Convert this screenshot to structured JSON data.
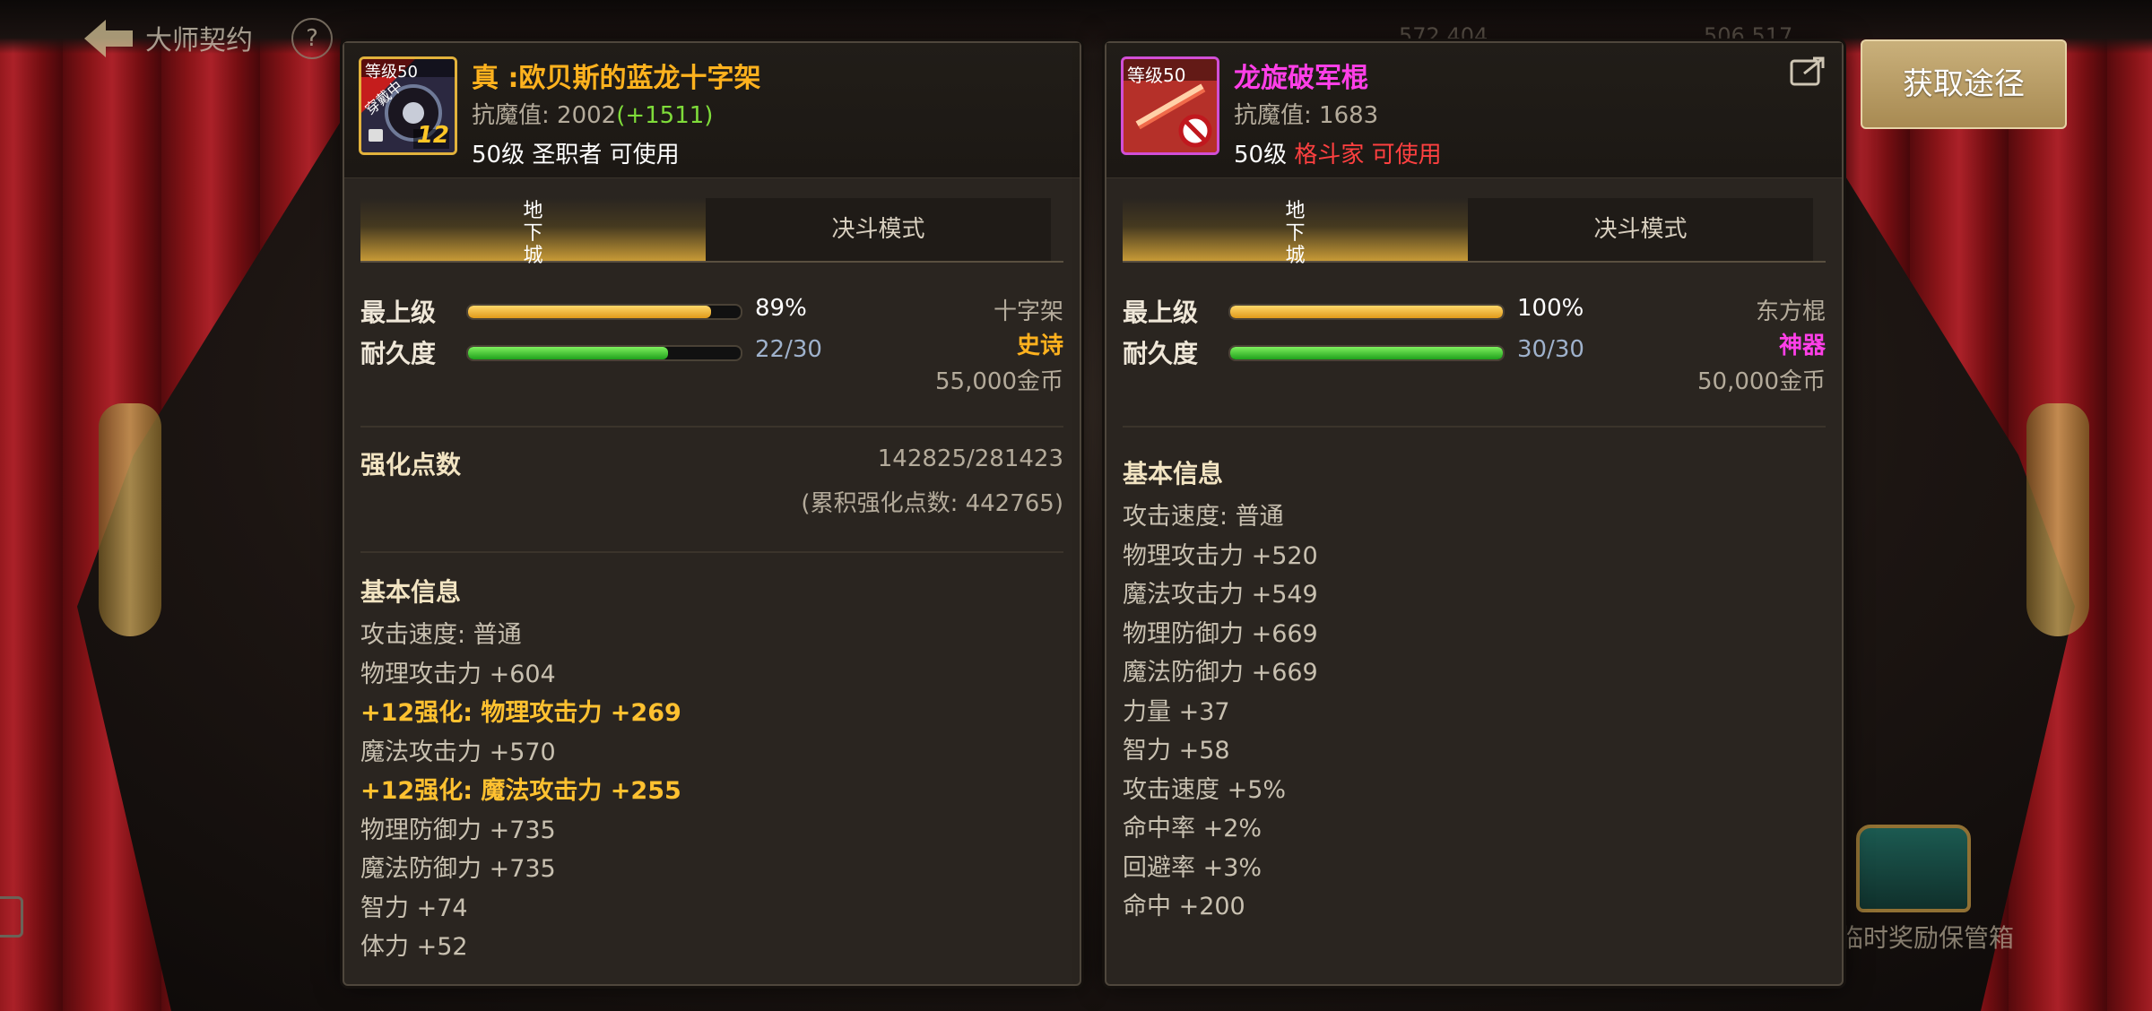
{
  "background": {
    "title": "大师契约",
    "help_icon": "?",
    "chest_label": "临时奖励保管箱",
    "behind_numbers": [
      "572,404",
      "506,517"
    ]
  },
  "button": {
    "obtain_label": "获取途径"
  },
  "left_item": {
    "name": "真 :欧贝斯的蓝龙十字架",
    "name_color": "#ffb21e",
    "icon_badge_top": "等级50",
    "icon_ribbon": "穿戴中",
    "icon_level": "12",
    "resist_label": "抗魔值:",
    "resist_value": "2002",
    "resist_bonus": "(+1511)",
    "req_level": "50级",
    "req_class": "圣职者",
    "req_usable": "可使用",
    "tabs": {
      "active": "地下城",
      "inactive": "决斗模式"
    },
    "top_label": "最上级",
    "top_percent": 89,
    "top_text": "89%",
    "dur_label": "耐久度",
    "dur_fraction": 0.7333,
    "dur_text": "22/30",
    "type": "十字架",
    "rarity": "史诗",
    "price": "55,000金币",
    "enhance_title": "强化点数",
    "enhance_value": "142825/281423",
    "enhance_total": "(累积强化点数: 442765)",
    "info_title": "基本信息",
    "info_lines": [
      {
        "text": "攻击速度: 普通",
        "style": "normal"
      },
      {
        "text": "物理攻击力 +604",
        "style": "normal"
      },
      {
        "text": "+12强化: 物理攻击力 +269",
        "style": "gold"
      },
      {
        "text": "魔法攻击力 +570",
        "style": "normal"
      },
      {
        "text": "+12强化: 魔法攻击力 +255",
        "style": "gold"
      },
      {
        "text": "物理防御力 +735",
        "style": "normal"
      },
      {
        "text": "魔法防御力 +735",
        "style": "normal"
      },
      {
        "text": "智力 +74",
        "style": "normal"
      },
      {
        "text": "体力 +52",
        "style": "normal"
      }
    ]
  },
  "right_item": {
    "name": "龙旋破军棍",
    "name_color": "#ff3fe8",
    "icon_badge_top": "等级50",
    "resist_label": "抗魔值:",
    "resist_value": "1683",
    "req_level": "50级",
    "req_class": "格斗家",
    "req_usable": "可使用",
    "tabs": {
      "active": "地下城",
      "inactive": "决斗模式"
    },
    "top_label": "最上级",
    "top_percent": 100,
    "top_text": "100%",
    "dur_label": "耐久度",
    "dur_fraction": 1.0,
    "dur_text": "30/30",
    "type": "东方棍",
    "rarity": "神器",
    "price": "50,000金币",
    "info_title": "基本信息",
    "info_lines": [
      {
        "text": "攻击速度: 普通",
        "style": "normal"
      },
      {
        "text": "物理攻击力 +520",
        "style": "normal"
      },
      {
        "text": "魔法攻击力 +549",
        "style": "normal"
      },
      {
        "text": "物理防御力 +669",
        "style": "normal"
      },
      {
        "text": "魔法防御力 +669",
        "style": "normal"
      },
      {
        "text": "力量 +37",
        "style": "normal"
      },
      {
        "text": "智力 +58",
        "style": "normal"
      },
      {
        "text": "攻击速度 +5%",
        "style": "normal"
      },
      {
        "text": "命中率 +2%",
        "style": "normal"
      },
      {
        "text": "回避率 +3%",
        "style": "normal"
      },
      {
        "text": "命中 +200",
        "style": "normal"
      }
    ]
  }
}
